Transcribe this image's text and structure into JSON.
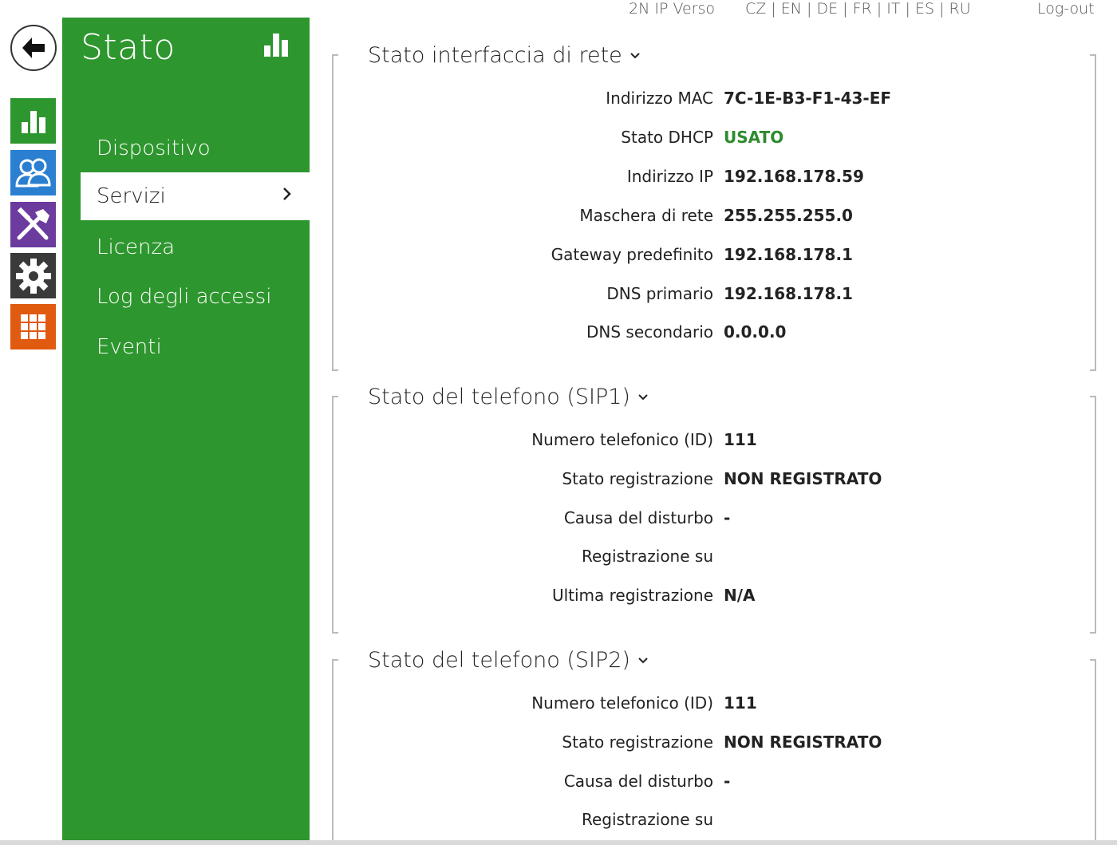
{
  "topbar": {
    "product": "2N IP Verso",
    "languages": [
      "CZ",
      "EN",
      "DE",
      "FR",
      "IT",
      "ES",
      "RU"
    ],
    "separator": " | ",
    "logout": "Log-out"
  },
  "rail": {
    "colors": {
      "status": "#2e962e",
      "directory": "#2a7fd1",
      "services": "#6b3b9e",
      "system": "#3a3a3a",
      "hardware": "#e05a10"
    }
  },
  "menu": {
    "title": "Stato",
    "items": [
      {
        "label": "Dispositivo"
      },
      {
        "label": "Servizi"
      },
      {
        "label": "Licenza"
      },
      {
        "label": "Log degli accessi"
      },
      {
        "label": "Eventi"
      }
    ],
    "accent": "#2e962e"
  },
  "network": {
    "title": "Stato interfaccia di rete",
    "rows": [
      {
        "label": "Indirizzo MAC",
        "value": "7C-1E-B3-F1-43-EF"
      },
      {
        "label": "Stato DHCP",
        "value": "USATO"
      },
      {
        "label": "Indirizzo IP",
        "value": "192.168.178.59"
      },
      {
        "label": "Maschera di rete",
        "value": "255.255.255.0"
      },
      {
        "label": "Gateway predefinito",
        "value": "192.168.178.1"
      },
      {
        "label": "DNS primario",
        "value": "192.168.178.1"
      },
      {
        "label": "DNS secondario",
        "value": "0.0.0.0"
      }
    ]
  },
  "sip1": {
    "title": "Stato del telefono (SIP1)",
    "rows": [
      {
        "label": "Numero telefonico (ID)",
        "value": "111"
      },
      {
        "label": "Stato registrazione",
        "value": "NON REGISTRATO"
      },
      {
        "label": "Causa del disturbo",
        "value": "-"
      },
      {
        "label": "Registrazione su",
        "value": ""
      },
      {
        "label": "Ultima registrazione",
        "value": "N/A"
      }
    ]
  },
  "sip2": {
    "title": "Stato del telefono (SIP2)",
    "rows": [
      {
        "label": "Numero telefonico (ID)",
        "value": "111"
      },
      {
        "label": "Stato registrazione",
        "value": "NON REGISTRATO"
      },
      {
        "label": "Causa del disturbo",
        "value": "-"
      },
      {
        "label": "Registrazione su",
        "value": ""
      }
    ]
  }
}
